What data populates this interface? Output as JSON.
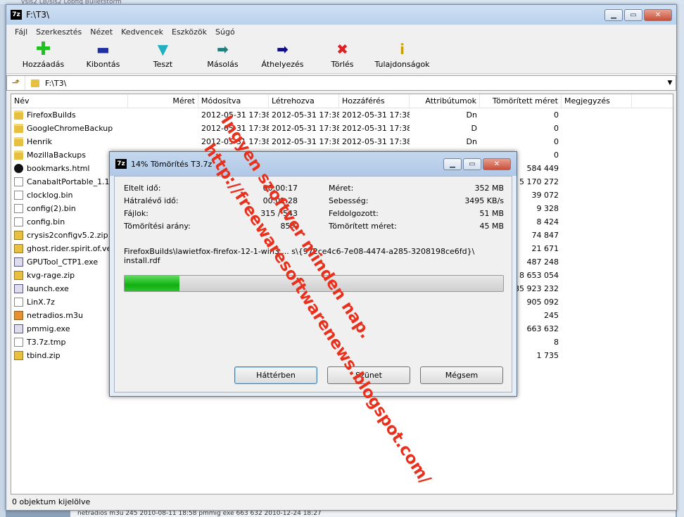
{
  "background": {
    "top_text": "ysis2   LB/sis2 Lobfig   Bulletstorm",
    "bottom_text": "netradios   m3u   245 2010-08-11 18:58   pmmig   exe   663 632 2010-12-24 18:27"
  },
  "window": {
    "icon": "7z",
    "title": "F:\\T3\\"
  },
  "menu": [
    "Fájl",
    "Szerkesztés",
    "Nézet",
    "Kedvencek",
    "Eszközök",
    "Súgó"
  ],
  "toolbar": [
    {
      "label": "Hozzáadás",
      "icon": "plus-icon",
      "glyph": "✚"
    },
    {
      "label": "Kibontás",
      "icon": "minus-icon",
      "glyph": "▬"
    },
    {
      "label": "Teszt",
      "icon": "check-chevron-icon",
      "glyph": "▼"
    },
    {
      "label": "Másolás",
      "icon": "copy-arrow-icon",
      "glyph": "➡"
    },
    {
      "label": "Áthelyezés",
      "icon": "move-arrow-icon",
      "glyph": "➡"
    },
    {
      "label": "Törlés",
      "icon": "delete-x-icon",
      "glyph": "✖"
    },
    {
      "label": "Tulajdonságok",
      "icon": "info-icon",
      "glyph": "i"
    }
  ],
  "address": {
    "path": "F:\\T3\\"
  },
  "columns": [
    "Név",
    "Méret",
    "Módosítva",
    "Létrehozva",
    "Hozzáférés",
    "Attribútumok",
    "Tömörített méret",
    "Megjegyzés"
  ],
  "files": [
    {
      "name": "FirefoxBuilds",
      "type": "folder",
      "mod": "2012-05-31 17:38",
      "cre": "2012-05-31 17:38",
      "acc": "2012-05-31 17:38",
      "attr": "Dn",
      "comp": "0"
    },
    {
      "name": "GoogleChromeBackup",
      "type": "folder",
      "mod": "2012-05-31 17:38",
      "cre": "2012-05-31 17:38",
      "acc": "2012-05-31 17:38",
      "attr": "D",
      "comp": "0"
    },
    {
      "name": "Henrik",
      "type": "folder",
      "mod": "2012-05-31 17:38",
      "cre": "2012-05-31 17:38",
      "acc": "2012-05-31 17:38",
      "attr": "Dn",
      "comp": "0"
    },
    {
      "name": "MozillaBackups",
      "type": "folder",
      "mod": "",
      "cre": "",
      "acc": "",
      "attr": "",
      "comp": "0"
    },
    {
      "name": "bookmarks.html",
      "type": "html",
      "mod": "",
      "cre": "",
      "acc": "",
      "attr": "",
      "comp": "584 449"
    },
    {
      "name": "CanabaltPortable_1.1_",
      "type": "file",
      "mod": "",
      "cre": "",
      "acc": "",
      "attr": "",
      "comp": "5 170 272"
    },
    {
      "name": "clocklog.bin",
      "type": "file",
      "mod": "",
      "cre": "",
      "acc": "",
      "attr": "",
      "comp": "39 072"
    },
    {
      "name": "config(2).bin",
      "type": "file",
      "mod": "",
      "cre": "",
      "acc": "",
      "attr": "",
      "comp": "9 328"
    },
    {
      "name": "config.bin",
      "type": "file",
      "mod": "",
      "cre": "",
      "acc": "",
      "attr": "",
      "comp": "8 424"
    },
    {
      "name": "crysis2configv5.2.zip",
      "type": "zip",
      "mod": "",
      "cre": "",
      "acc": "",
      "attr": "",
      "comp": "74 847"
    },
    {
      "name": "ghost.rider.spirit.of.ven",
      "type": "zip",
      "mod": "",
      "cre": "",
      "acc": "",
      "attr": "",
      "comp": "21 671"
    },
    {
      "name": "GPUTool_CTP1.exe",
      "type": "exe",
      "mod": "",
      "cre": "",
      "acc": "",
      "attr": "",
      "comp": "487 248"
    },
    {
      "name": "kvg-rage.zip",
      "type": "zip",
      "mod": "",
      "cre": "",
      "acc": "",
      "attr": "",
      "comp": "8 653 054"
    },
    {
      "name": "launch.exe",
      "type": "exe",
      "mod": "",
      "cre": "",
      "acc": "",
      "attr": "",
      "comp": "85 923 232"
    },
    {
      "name": "LinX.7z",
      "type": "file",
      "mod": "",
      "cre": "",
      "acc": "",
      "attr": "",
      "comp": "905 092"
    },
    {
      "name": "netradios.m3u",
      "type": "m3u",
      "mod": "",
      "cre": "",
      "acc": "",
      "attr": "",
      "comp": "245"
    },
    {
      "name": "pmmig.exe",
      "type": "exe",
      "mod": "",
      "cre": "",
      "acc": "",
      "attr": "",
      "comp": "663 632"
    },
    {
      "name": "T3.7z.tmp",
      "type": "file",
      "mod": "",
      "cre": "",
      "acc": "",
      "attr": "",
      "comp": "8"
    },
    {
      "name": "tbind.zip",
      "type": "zip",
      "mod": "",
      "cre": "",
      "acc": "",
      "attr": "",
      "comp": "1 735"
    }
  ],
  "status": {
    "text": "0 objektum kijelölve"
  },
  "dialog": {
    "icon": "7z",
    "title": "14% Tömörítés T3.7z",
    "elapsed_label": "Eltelt idő:",
    "elapsed_value": "00:00:17",
    "remaining_label": "Hátralévő idő:",
    "remaining_value": "00:01:28",
    "files_label": "Fájlok:",
    "files_value": "315 / 543",
    "ratio_label": "Tömörítési arány:",
    "ratio_value": "85%",
    "size_label": "Méret:",
    "size_value": "352 MB",
    "speed_label": "Sebesség:",
    "speed_value": "3495 KB/s",
    "processed_label": "Feldolgozott:",
    "processed_value": "51 MB",
    "compressed_label": "Tömörített méret:",
    "compressed_value": "45 MB",
    "current_path": "FirefoxBuilds\\lawietfox-firefox-12-1-win3 ... s\\{972ce4c6-7e08-4474-a285-3208198ce6fd}\\",
    "current_file": "install.rdf",
    "progress_fraction": 0.145,
    "btn_background": "Háttérben",
    "btn_pause": "Szünet",
    "btn_cancel": "Mégsem"
  },
  "watermark": {
    "line1": "Ingyen szoftver minden nap.",
    "line2": "http://freewaresoftwarenews.blogspot.com/",
    "color": "#e8301c"
  }
}
